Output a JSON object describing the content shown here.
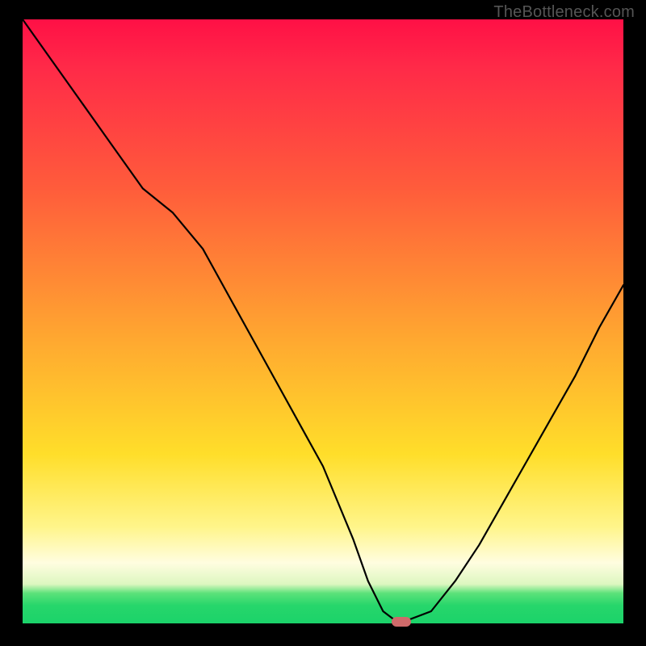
{
  "watermark": {
    "text": "TheBottleneck.com"
  },
  "chart_data": {
    "type": "line",
    "title": "",
    "xlabel": "",
    "ylabel": "",
    "x": [
      0.0,
      0.05,
      0.1,
      0.15,
      0.2,
      0.25,
      0.3,
      0.35,
      0.4,
      0.45,
      0.5,
      0.55,
      0.575,
      0.6,
      0.62,
      0.64,
      0.68,
      0.72,
      0.76,
      0.8,
      0.84,
      0.88,
      0.92,
      0.96,
      1.0
    ],
    "values": [
      1.0,
      0.93,
      0.86,
      0.79,
      0.72,
      0.68,
      0.62,
      0.53,
      0.44,
      0.35,
      0.26,
      0.14,
      0.07,
      0.02,
      0.005,
      0.005,
      0.02,
      0.07,
      0.13,
      0.2,
      0.27,
      0.34,
      0.41,
      0.49,
      0.56
    ],
    "xlim": [
      0,
      1
    ],
    "ylim": [
      0,
      1
    ],
    "marker": {
      "x": 0.63,
      "y": 0.0
    },
    "background_gradient": {
      "stops": [
        {
          "pos": 0.0,
          "color": "#ff1046"
        },
        {
          "pos": 0.28,
          "color": "#ff5c3b"
        },
        {
          "pos": 0.53,
          "color": "#ffa830"
        },
        {
          "pos": 0.72,
          "color": "#ffde2a"
        },
        {
          "pos": 0.9,
          "color": "#fffde0"
        },
        {
          "pos": 0.97,
          "color": "#27d66b"
        },
        {
          "pos": 1.0,
          "color": "#1bd36a"
        }
      ]
    }
  }
}
